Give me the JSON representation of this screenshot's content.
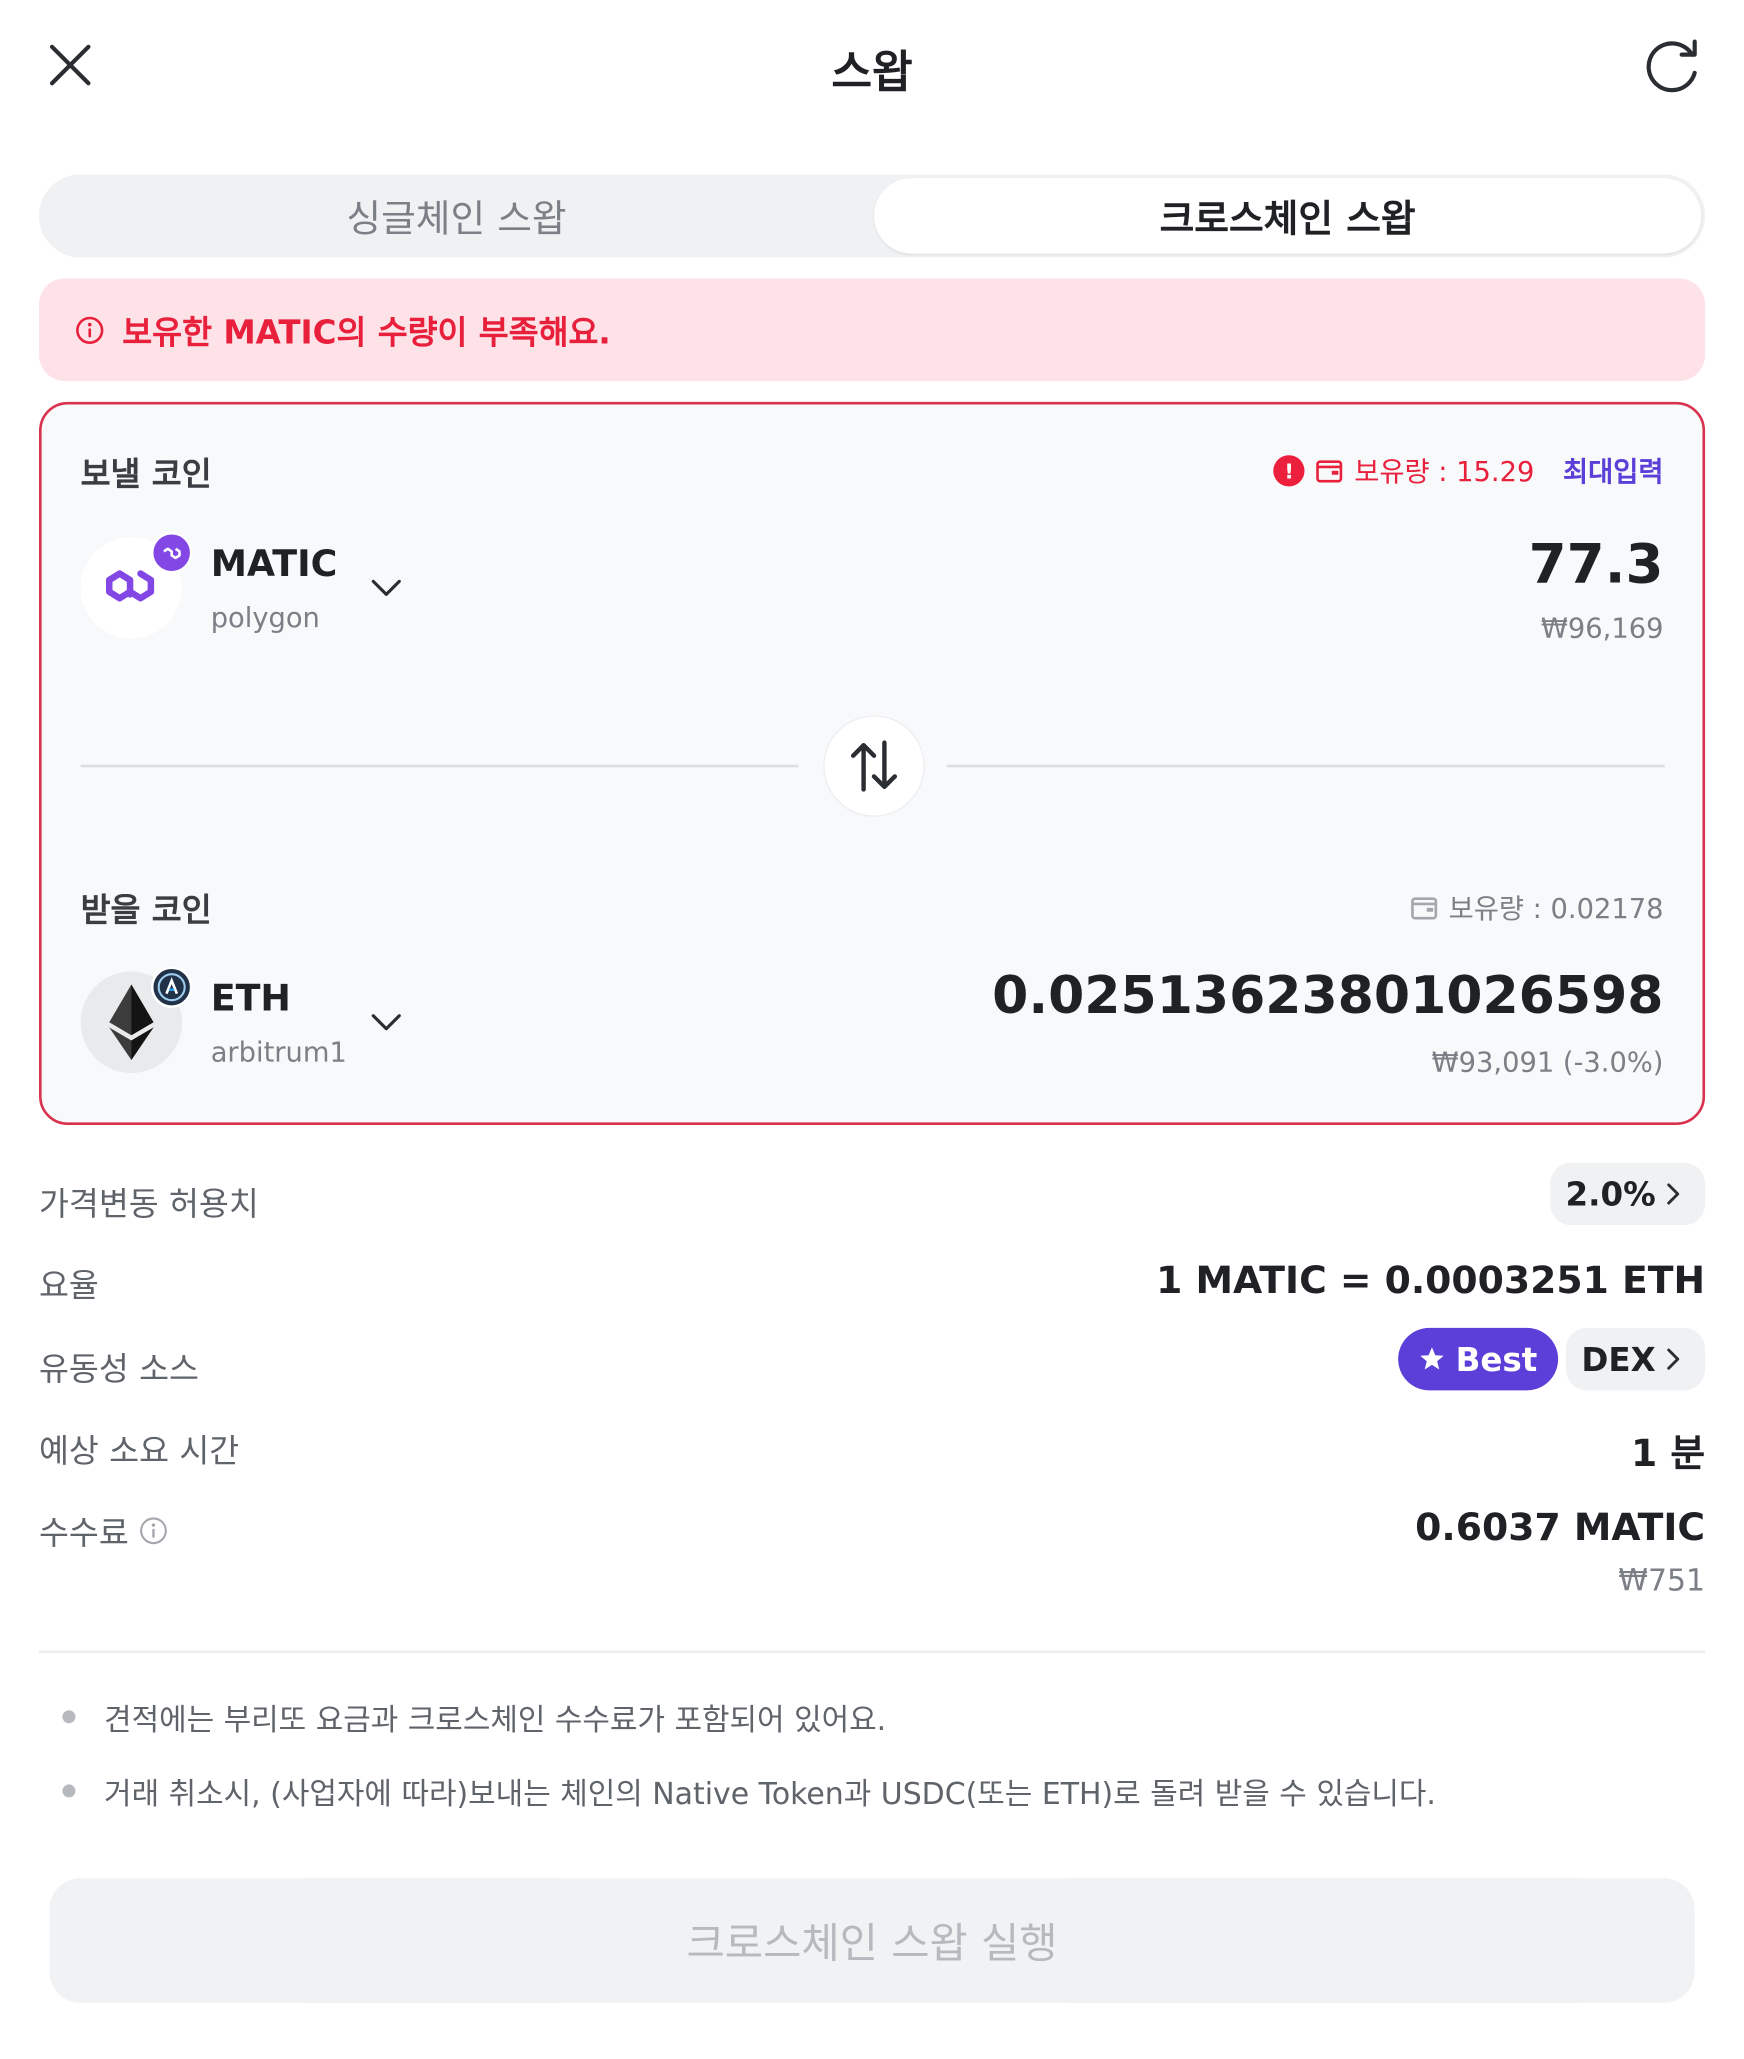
{
  "header": {
    "title": "스왑"
  },
  "tabs": [
    {
      "label": "싱글체인 스왑"
    },
    {
      "label": "크로스체인 스왑"
    }
  ],
  "alert": {
    "text": "보유한 MATIC의 수량이 부족해요."
  },
  "send": {
    "label": "보낼 코인",
    "balance": "보유량 : 15.29",
    "max_label": "최대입력",
    "coin": "MATIC",
    "chain": "polygon",
    "amount": "77.3",
    "fiat": "₩96,169"
  },
  "receive": {
    "label": "받을 코인",
    "balance": "보유량 : 0.02178",
    "coin": "ETH",
    "chain": "arbitrum1",
    "amount": "0.025136238010265​98",
    "fiat": "₩93,091 (-3.0%)"
  },
  "details": {
    "slippage_label": "가격변동 허용치",
    "slippage_value": "2.0%",
    "rate_label": "요율",
    "rate_value": "1 MATIC = 0.0003251 ETH",
    "source_label": "유동성 소스",
    "best_label": "Best",
    "source_value": "DEX",
    "time_label": "예상 소요 시간",
    "time_value": "1 분",
    "fee_label": "수수료",
    "fee_value": "0.6037 MATIC",
    "fee_fiat": "₩751"
  },
  "notes": [
    "견적에는 부리또 요금과 크로스체인 수수료가 포함되어 있어요.",
    "거래 취소시, (사업자에 따라)보내는 체인의 Native Token과 USDC(또는 ETH)로 돌려 받을 수 있습니다."
  ],
  "cta": {
    "label": "크로스체인 스왑 실행"
  },
  "colors": {
    "accent": "#5b3fd8",
    "error": "#e8203c",
    "matic": "#8247e5"
  }
}
